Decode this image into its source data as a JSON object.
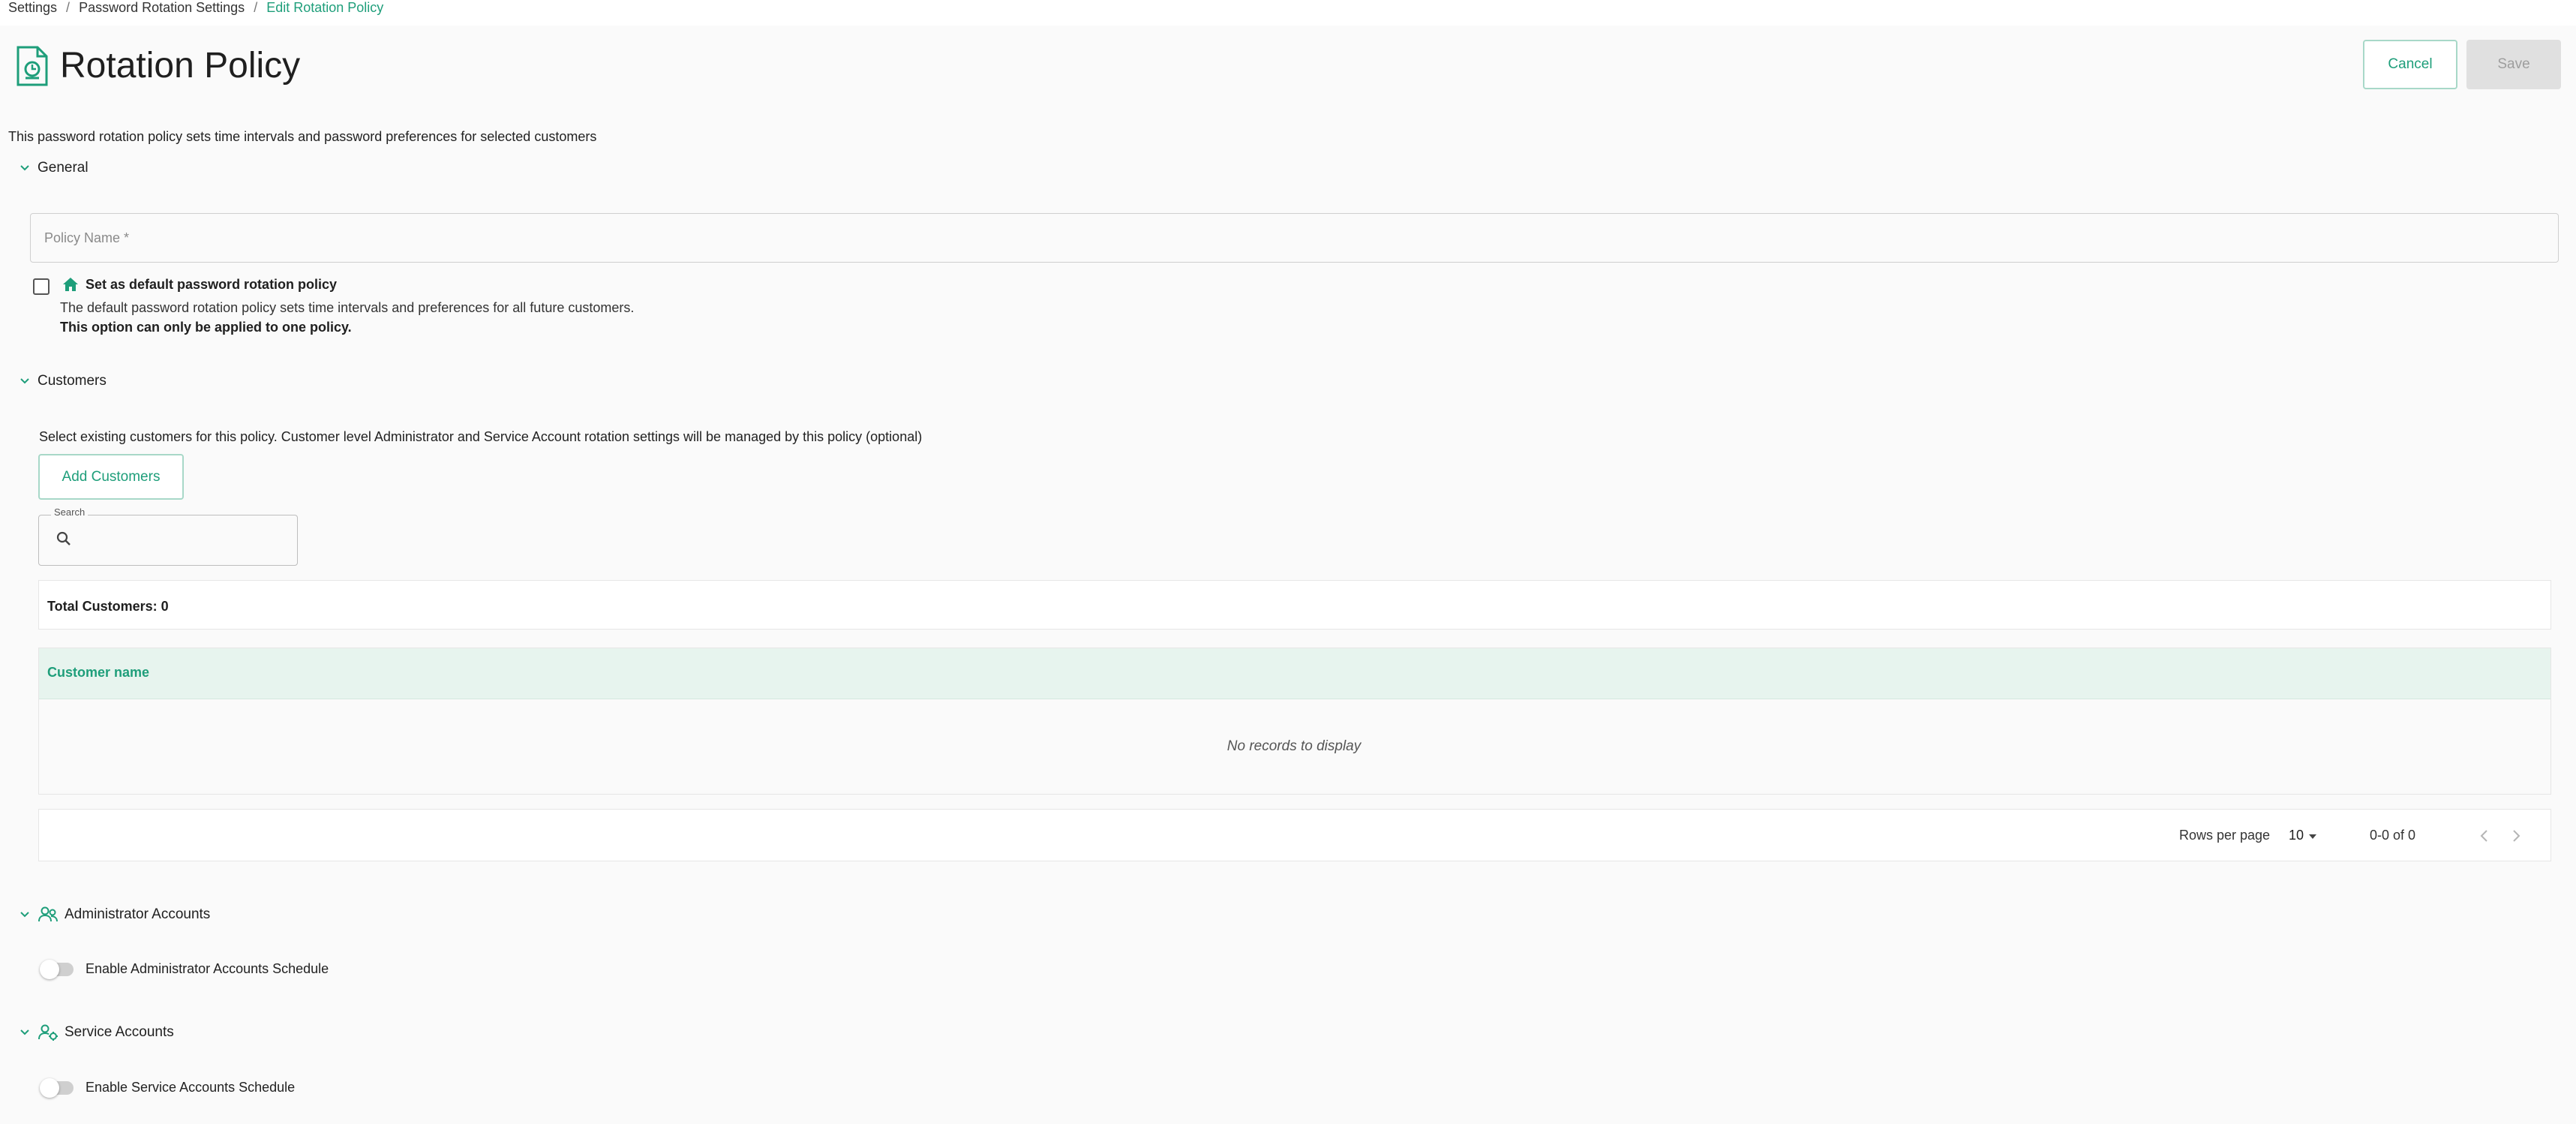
{
  "breadcrumb": {
    "items": [
      "Settings",
      "Password Rotation Settings"
    ],
    "current": "Edit Rotation Policy",
    "separator": "/"
  },
  "header": {
    "title": "Rotation Policy",
    "icon": "policy-document-icon",
    "cancel_label": "Cancel",
    "save_label": "Save"
  },
  "intro": "This password rotation policy sets time intervals and password preferences for selected customers",
  "general": {
    "title": "General",
    "policy_name_placeholder": "Policy Name *",
    "policy_name_value": "",
    "default_checked": false,
    "default_title": "Set as default password rotation policy",
    "default_desc": "The default password rotation policy sets time intervals and preferences for all future customers.",
    "default_note": "This option can only be applied to one policy."
  },
  "customers": {
    "title": "Customers",
    "description": "Select existing customers for this policy. Customer level Administrator and Service Account rotation settings will be managed by this policy (optional)",
    "add_label": "Add Customers",
    "search_label": "Search",
    "search_value": "",
    "total_text": "Total Customers: 0",
    "column_header": "Customer name",
    "empty_text": "No records to display",
    "rows_per_page_label": "Rows per page",
    "rows_per_page_value": "10",
    "range_text": "0-0 of 0"
  },
  "admin": {
    "title": "Administrator Accounts",
    "toggle_label": "Enable Administrator Accounts Schedule",
    "enabled": false
  },
  "service": {
    "title": "Service Accounts",
    "toggle_label": "Enable Service Accounts Schedule",
    "enabled": false
  },
  "colors": {
    "accent": "#1e9e7a",
    "table_header_bg": "#e7f4ee",
    "disabled_bg": "#e0e0e0"
  }
}
